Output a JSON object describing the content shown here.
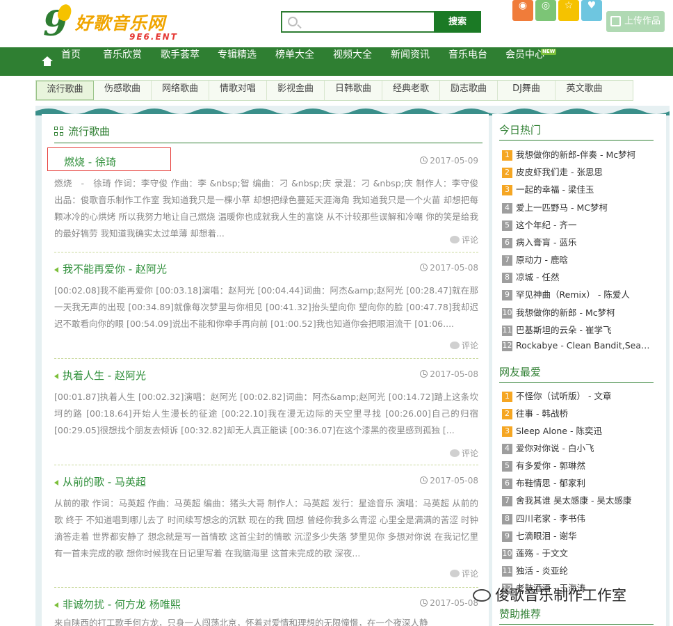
{
  "header": {
    "logo_text": "好歌音乐网",
    "logo_sub": "9E6.ENT",
    "search_placeholder": "",
    "search_button": "搜索",
    "upload_label": "上传作品"
  },
  "colors": {
    "brand_green": "#2f7f32",
    "social": [
      "#f07c3a",
      "#7cc576",
      "#f5c200",
      "#6ec6e0"
    ]
  },
  "social_icons": [
    "weibo-icon",
    "chat-icon",
    "star-icon",
    "heart-icon"
  ],
  "nav": {
    "items": [
      "首页",
      "音乐欣赏",
      "歌手荟萃",
      "专辑精选",
      "榜单大全",
      "视频大全",
      "新闻资讯",
      "音乐电台",
      "会员中心"
    ],
    "badge": "NEW"
  },
  "subnav": [
    "流行歌曲",
    "伤感歌曲",
    "网络歌曲",
    "情歌对唱",
    "影视金曲",
    "日韩歌曲",
    "经典老歌",
    "励志歌曲",
    "DJ舞曲",
    "英文歌曲"
  ],
  "main": {
    "section_title": "流行歌曲",
    "comment_label": "评论",
    "articles": [
      {
        "title": "燃烧 - 徐琦",
        "date": "2017-05-09",
        "body": "燃烧　-　徐琦 作词：李守俊 作曲：李 &nbsp;智 编曲：刁 &nbsp;庆 录混：刁 &nbsp;庆 制作人：李守俊 出品：俊歌音乐制作工作室 我知道我只是一棵小草 却想把绿色蔓延天涯海角 我知道我只是一个火苗 却想把每颗冰冷的心烘烤 所以我努力地让自己燃烧 温暖你也成就我人生的富饶 从不计较那些误解和冷嘲 你的笑是给我的最好犒劳 我知道我确实太过单薄 却想着..."
      },
      {
        "title": "我不能再爱你 - 赵阿光",
        "date": "2017-05-08",
        "body": "[00:02.08]我不能再爱你 [00:03.18]演唱：赵阿光 [00:04.44]词曲：阿杰&amp;赵阿光 [00:28.47]就在那一天我无声的出现 [00:34.89]就像每次梦里与你相见 [00:41.32]抬头望向你 望向你的脸 [00:47.78]我却迟迟不敢看向你的眼 [00:54.09]说出不能和你牵手再向前 [01:00.52]我也知道你会把眼泪流干 [01:06...."
      },
      {
        "title": "执着人生 - 赵阿光",
        "date": "2017-05-08",
        "body": "[00:01.87]执着人生 [00:02.32]演唱：赵阿光 [00:02.82]词曲：阿杰&amp;赵阿光 [00:14.72]踏上这条坎坷的路 [00:18.64]开始人生漫长的征途 [00:22.10]我在漫无边际的天空里寻找 [00:26.00]自己的归宿 [00:29.05]很想找个朋友去倾诉 [00:32.82]却无人真正能读 [00:36.07]在这个漆黑的夜里感到孤独 [..."
      },
      {
        "title": "从前的歌 - 马英超",
        "date": "2017-05-08",
        "body": "从前的歌 作词：马英超 作曲：马英超 编曲：猪头大哥 制作人：马英超 发行：星途音乐 演唱：马英超 从前的歌 终于 不知道唱到哪儿去了 时间续写想念的沉默 现在的我 回想 曾经你我多么青涩 心里全是满满的苦涩 时钟滴答走着 世界都安静了 想念就是写一首情歌 这首尘封的情歌 沉涩多少失落 梦里见你 多想对你说 在我记忆里 有一首未完成的歌 想你时候我在日记里写着 在我脑海里 这首未完成的歌 深夜..."
      },
      {
        "title": "非诚勿扰 - 何方龙 杨唯熙",
        "date": "2017-05-08",
        "body": "来自陕西的打工歌手何方龙，只身一人闯荡北京，怀着对爱情和理想的无限憧憬，在一个夜深人静"
      }
    ]
  },
  "sidebar": {
    "hot_title": "今日热门",
    "hot": [
      "我想做你的新郎-伴奏 - Mc梦柯",
      "皮皮虾我们走 - 张思思",
      "一起的幸福 - 梁佳玉",
      "爱上一匹野马 - MC梦柯",
      "这个年纪 - 齐一",
      "病入膏肓 - 蓝乐",
      "原动力 - 鹿晗",
      "凉城 - 任然",
      "罕见神曲（Remix） - 陈爱人",
      "我想做你的新郎 - Mc梦柯",
      "巴基斯坦的云朵 - 崔学飞",
      "Rockabye - Clean Bandit,Sean Paul"
    ],
    "fav_title": "网友最爱",
    "fav": [
      "不怪你（试听版） - 文章",
      "往事 - 韩战桥",
      "Sleep Alone - 陈奕迅",
      "爱你对你说 - 白小飞",
      "有多爱你 - 郭琳然",
      "布鞋情思 - 郁家利",
      "舍我其谁 吴太感康 - 吴太感康",
      "四川老家 - 李书伟",
      "七滴眼泪 - 谢华",
      "莲殇 - 于文文",
      "独活 - 炎亚纶",
      "老鼓酒酒 - 王海涛"
    ],
    "sponsor_title": "赞助推荐"
  },
  "watermark": "俊歌音乐制作工作室"
}
